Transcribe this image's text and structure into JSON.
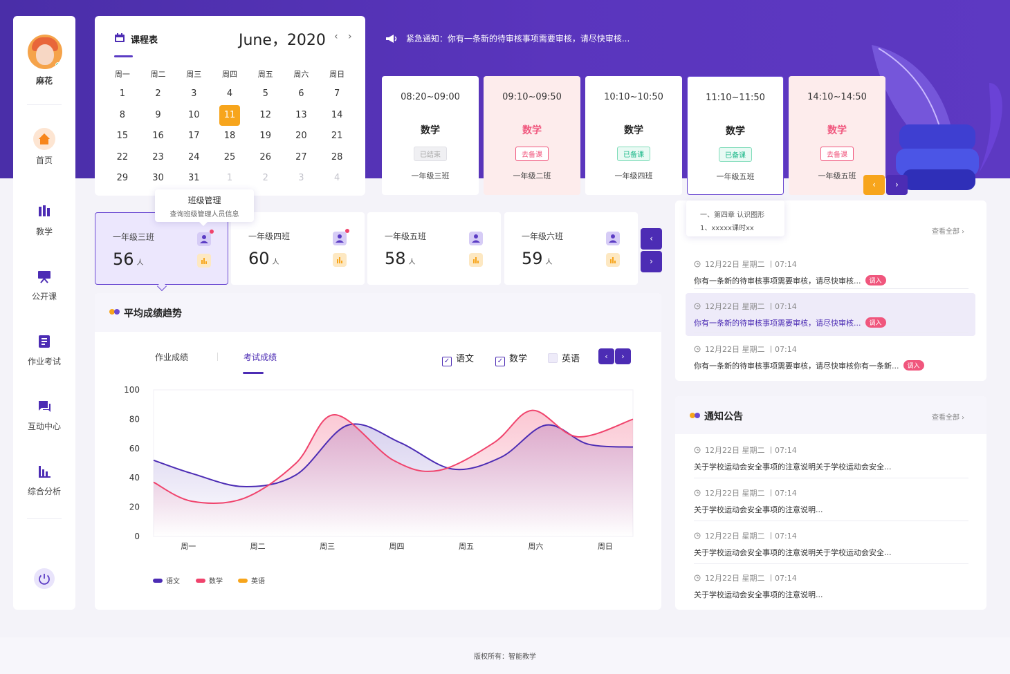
{
  "user": {
    "name": "麻花"
  },
  "nav": [
    {
      "label": "首页",
      "icon": "home-icon"
    },
    {
      "label": "教学",
      "icon": "teaching-icon"
    },
    {
      "label": "公开课",
      "icon": "public-class-icon"
    },
    {
      "label": "作业考试",
      "icon": "homework-icon"
    },
    {
      "label": "互动中心",
      "icon": "chat-icon"
    },
    {
      "label": "综合分析",
      "icon": "analysis-icon"
    }
  ],
  "calendar": {
    "title": "课程表",
    "month": "June，2020",
    "prev": "‹",
    "next": "›",
    "weekdays": [
      "周一",
      "周二",
      "周三",
      "周四",
      "周五",
      "周六",
      "周日"
    ],
    "days": [
      "1",
      "2",
      "3",
      "4",
      "5",
      "6",
      "7",
      "8",
      "9",
      "10",
      "11",
      "12",
      "13",
      "14",
      "15",
      "16",
      "17",
      "18",
      "19",
      "20",
      "21",
      "22",
      "23",
      "24",
      "25",
      "26",
      "27",
      "28",
      "29",
      "30",
      "31",
      "1",
      "2",
      "3",
      "4"
    ],
    "today": "11"
  },
  "tooltip": {
    "title": "班级管理",
    "desc": "查询班级管理人员信息"
  },
  "notice": "紧急通知：你有一条新的待审核事项需要审核，请尽快审核...",
  "schedule": [
    {
      "time": "08:20~09:00",
      "subject": "数学",
      "status": "已结束",
      "class": "一年级三班",
      "style": "done"
    },
    {
      "time": "09:10~09:50",
      "subject": "数学",
      "status": "去备课",
      "class": "一年级二班",
      "style": "go"
    },
    {
      "time": "10:10~10:50",
      "subject": "数学",
      "status": "已备课",
      "class": "一年级四班",
      "style": "ok"
    },
    {
      "time": "11:10~11:50",
      "subject": "数学",
      "status": "已备课",
      "class": "一年级五班",
      "style": "ok"
    },
    {
      "time": "14:10~14:50",
      "subject": "数学",
      "status": "去备课",
      "class": "一年级五班",
      "style": "go"
    }
  ],
  "schedule_nav": {
    "prev": "‹",
    "next": "›"
  },
  "popup": {
    "line1": "一、第四章 认识图形",
    "line2": "1、xxxxx课时xx"
  },
  "classes": [
    {
      "name": "一年级三班",
      "count": "56",
      "unit": "人"
    },
    {
      "name": "一年级四班",
      "count": "60",
      "unit": "人"
    },
    {
      "name": "一年级五班",
      "count": "58",
      "unit": "人"
    },
    {
      "name": "一年级六班",
      "count": "59",
      "unit": "人"
    }
  ],
  "class_nav": {
    "prev": "‹",
    "next": "›"
  },
  "chart": {
    "title": "平均成绩趋势",
    "tabs": [
      "作业成绩",
      "考试成绩"
    ],
    "active_tab": "考试成绩",
    "filters": [
      {
        "label": "语文",
        "checked": true
      },
      {
        "label": "数学",
        "checked": true
      },
      {
        "label": "英语",
        "checked": false
      }
    ],
    "nav": {
      "prev": "‹",
      "next": "›"
    },
    "legend": [
      {
        "label": "语文",
        "color": "#4c2cb4"
      },
      {
        "label": "数学",
        "color": "#f0436c"
      },
      {
        "label": "英语",
        "color": "#f7a51c"
      }
    ]
  },
  "chart_data": {
    "type": "line",
    "categories": [
      "周一",
      "周二",
      "周三",
      "周四",
      "周五",
      "周六",
      "周日"
    ],
    "x_positions": [
      0.5,
      1.5,
      2.5,
      3.5,
      4.5,
      5.5,
      6.5
    ],
    "xlim": [
      0,
      6.9
    ],
    "ylim": [
      0,
      100
    ],
    "yticks": [
      0,
      20,
      40,
      60,
      80,
      100
    ],
    "series": [
      {
        "name": "语文",
        "color": "#4c2cb4",
        "x": [
          0,
          0.55,
          1.3,
          2.05,
          2.8,
          3.55,
          4.3,
          5.0,
          5.65,
          6.25,
          6.9
        ],
        "values": [
          52,
          43,
          34,
          42,
          76,
          64,
          46,
          54,
          76,
          63,
          61
        ]
      },
      {
        "name": "数学",
        "color": "#f0436c",
        "x": [
          0,
          0.55,
          1.3,
          2.05,
          2.6,
          3.45,
          4.1,
          4.9,
          5.45,
          6.1,
          6.9
        ],
        "values": [
          37,
          24,
          26,
          50,
          83,
          52,
          45,
          64,
          86,
          68,
          80
        ]
      }
    ],
    "grid": true
  },
  "messages": {
    "view_all": "查看全部 ›",
    "items": [
      {
        "time": "12月22日 星期二 丨07:14",
        "text": "你有一条新的待审核事项需要审核，请尽快审核...",
        "badge": "调入",
        "highlight": false
      },
      {
        "time": "12月22日 星期二 丨07:14",
        "text": "你有一条新的待审核事项需要审核，请尽快审核...",
        "badge": "调入",
        "highlight": true
      },
      {
        "time": "12月22日 星期二 丨07:14",
        "text": "你有一条新的待审核事项需要审核，请尽快审核你有一条新...",
        "badge": "调入",
        "highlight": false
      }
    ]
  },
  "announcements": {
    "title": "通知公告",
    "view_all": "查看全部 ›",
    "items": [
      {
        "time": "12月22日 星期二 丨07:14",
        "text": "关于学校运动会安全事项的注意说明关于学校运动会安全..."
      },
      {
        "time": "12月22日 星期二 丨07:14",
        "text": "关于学校运动会安全事项的注意说明..."
      },
      {
        "time": "12月22日 星期二 丨07:14",
        "text": "关于学校运动会安全事项的注意说明关于学校运动会安全..."
      },
      {
        "time": "12月22日 星期二 丨07:14",
        "text": "关于学校运动会安全事项的注意说明..."
      }
    ]
  },
  "footer": "版权所有：智能教学"
}
